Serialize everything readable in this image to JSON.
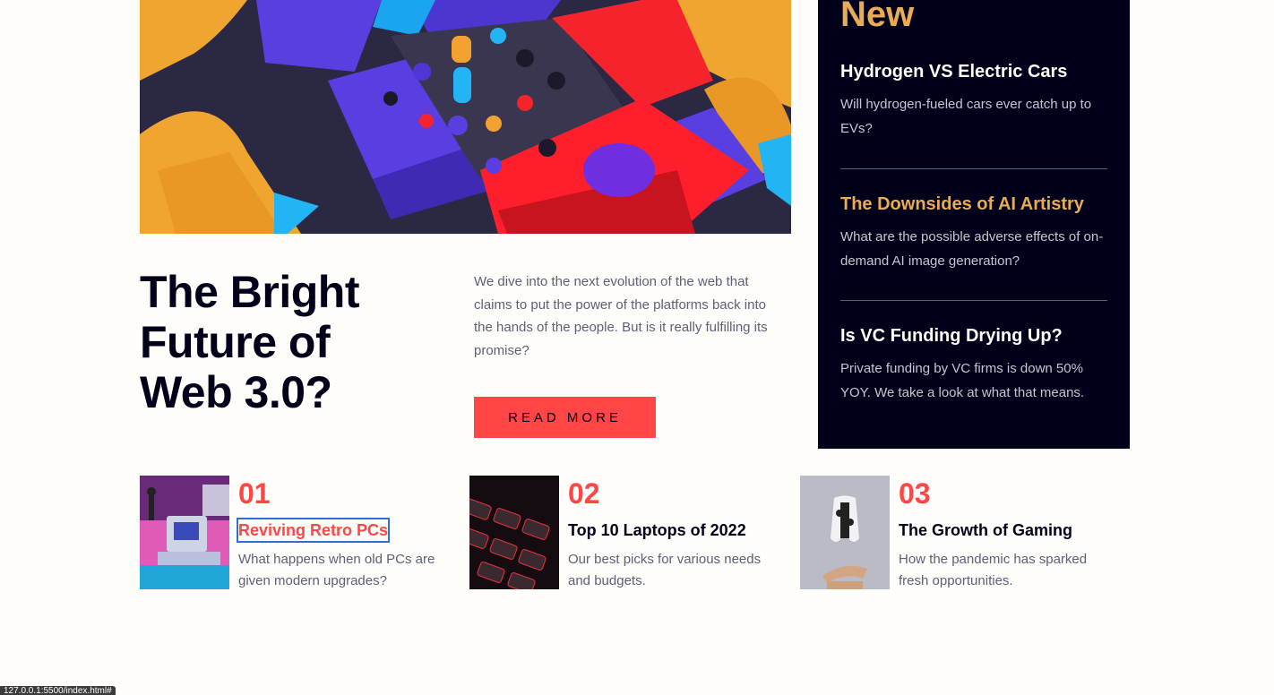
{
  "hero": {
    "title": "The Bright Future of Web 3.0?",
    "description": "We dive into the next evolution of the web that claims to put the power of the platforms back into the hands of the people. But is it really fulfilling its promise?",
    "cta_label": "READ MORE"
  },
  "sidebar": {
    "heading": "New",
    "items": [
      {
        "title": "Hydrogen VS Electric Cars",
        "text": "Will hydrogen-fueled cars ever catch up to EVs?"
      },
      {
        "title": "The Downsides of AI Artistry",
        "text": "What are the possible adverse effects of on-demand AI image generation?"
      },
      {
        "title": "Is VC Funding Drying Up?",
        "text": "Private funding by VC firms is down 50% YOY. We take a look at what that means."
      }
    ]
  },
  "cards": [
    {
      "number": "01",
      "title": "Reviving Retro PCs",
      "text": "What happens when old PCs are given modern upgrades?"
    },
    {
      "number": "02",
      "title": "Top 10 Laptops of 2022",
      "text": "Our best picks for various needs and budgets."
    },
    {
      "number": "03",
      "title": "The Growth of Gaming",
      "text": "How the pandemic has sparked fresh opportunities."
    }
  ],
  "status_url": "127.0.0.1:5500/index.html#",
  "colors": {
    "accent_red": "#ff4545",
    "accent_orange": "#e9ab53",
    "dark_navy": "#00001a",
    "off_white": "#fffdf9"
  }
}
